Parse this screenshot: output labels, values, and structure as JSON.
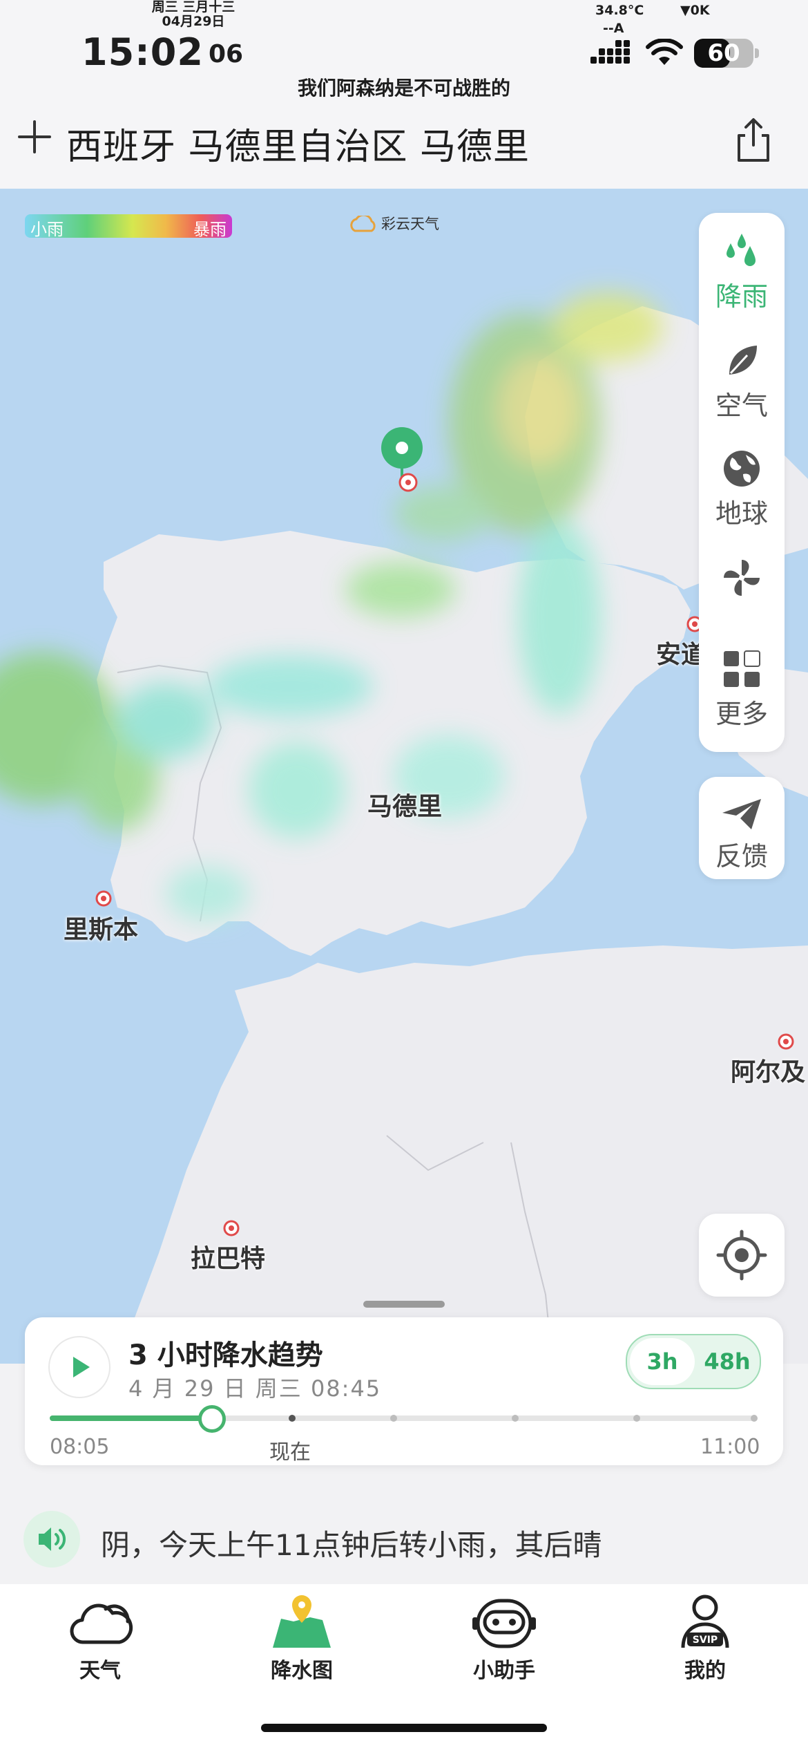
{
  "status_bar": {
    "lunar_weekday": "周三 三月十三",
    "date": "04月29日",
    "time": "15:02",
    "seconds": "06",
    "marquee": "我们阿森纳是不可战胜的",
    "temperature": "34.8°C",
    "network_speed": "▼0K",
    "carrier": "--A",
    "battery": "60"
  },
  "header": {
    "location": "西班牙 马德里自治区 马德里",
    "add_icon": "plus-icon",
    "share_icon": "share-icon"
  },
  "map": {
    "legend_light": "小雨",
    "legend_heavy": "暴雨",
    "brand": "彩云天气",
    "pin_city": "马德里",
    "cities": {
      "lisbon": "里斯本",
      "andorra": "安道",
      "algiers": "阿尔及",
      "rabat": "拉巴特"
    },
    "side_menu": [
      {
        "label": "降雨",
        "icon": "rain-drops-icon",
        "active": true
      },
      {
        "label": "空气",
        "icon": "leaf-icon",
        "active": false
      },
      {
        "label": "地球",
        "icon": "globe-icon",
        "active": false
      },
      {
        "label": "风",
        "icon": "pinwheel-icon",
        "active": false
      },
      {
        "label": "更多",
        "icon": "grid-icon",
        "active": false
      }
    ],
    "feedback_label": "反馈",
    "locate_icon": "crosshair-icon"
  },
  "precip_card": {
    "title": "3 小时降水趋势",
    "datetime": "4 月 29 日 周三 08:45",
    "range_options": [
      "3h",
      "48h"
    ],
    "selected_range": "3h",
    "timeline_start": "08:05",
    "timeline_now": "现在",
    "timeline_end": "11:00",
    "progress": 0.23
  },
  "summary": {
    "text": "阴，今天上午11点钟后转小雨，其后晴"
  },
  "tabs": [
    {
      "label": "天气",
      "icon": "cloud-icon"
    },
    {
      "label": "降水图",
      "icon": "map-pin-icon"
    },
    {
      "label": "小助手",
      "icon": "robot-icon"
    },
    {
      "label": "我的",
      "icon": "svip-user-icon"
    }
  ],
  "colors": {
    "accent": "#3bb575",
    "sea": "#b8d6f1",
    "land": "#ececf0"
  }
}
